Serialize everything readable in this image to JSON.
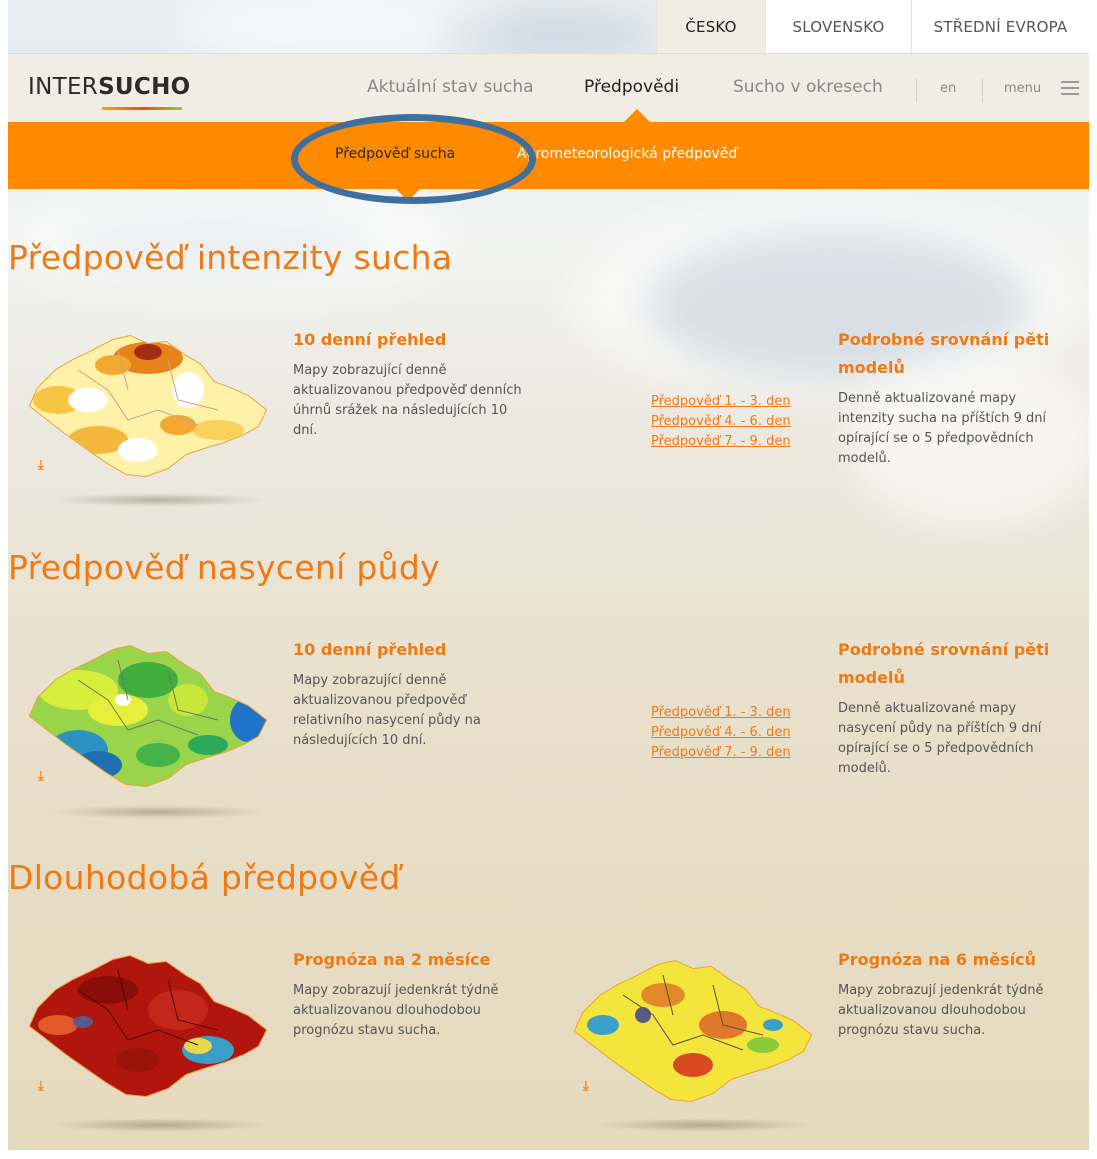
{
  "region_tabs": [
    "ČESKO",
    "SLOVENSKO",
    "STŘEDNÍ EVROPA"
  ],
  "logo": {
    "part1": "INTER",
    "part2": "SUCHO"
  },
  "nav": {
    "items": [
      "Aktuální stav sucha",
      "Předpovědi",
      "Sucho v okresech"
    ],
    "lang": "en",
    "menu": "menu"
  },
  "subnav": [
    "Předpověď sucha",
    "Agrometeorologická předpověď"
  ],
  "sections": [
    {
      "title": "Předpověď intenzity sucha",
      "left_card": {
        "title": "10 denní přehled",
        "text": [
          "Mapy zobrazující denně",
          "aktualizovanou předpověď denních",
          "úhrnů srážek na následujících 10",
          "dní."
        ]
      },
      "links": [
        "Předpověď 1. - 3. den",
        "Předpověď 4. - 6. den",
        "Předpověď 7. - 9. den"
      ],
      "right_card": {
        "title": [
          "Podrobné srovnání pěti",
          "modelů"
        ],
        "text": [
          "Denně aktualizované mapy",
          "intenzity sucha na příštích 9 dní",
          "opírající se o 5 předpovědních",
          "modelů."
        ]
      }
    },
    {
      "title": "Předpověď nasycení půdy",
      "left_card": {
        "title": "10 denní přehled",
        "text": [
          "Mapy zobrazující denně",
          "aktualizovanou předpověď",
          "relativního nasycení půdy na",
          "následujících 10 dní."
        ]
      },
      "links": [
        "Předpověď 1. - 3. den",
        "Předpověď 4. - 6. den",
        "Předpověď 7. - 9. den"
      ],
      "right_card": {
        "title": [
          "Podrobné srovnání pěti",
          "modelů"
        ],
        "text": [
          "Denně aktualizované mapy",
          "nasycení půdy na příštích 9 dní",
          "opírající se o 5 předpovědních",
          "modelů."
        ]
      }
    },
    {
      "title": "Dlouhodobá předpověď",
      "left_card": {
        "title": "Prognóza na 2 měsíce",
        "text": [
          "Mapy zobrazují jedenkrát týdně",
          "aktualizovanou dlouhodobou",
          "prognózu stavu sucha."
        ]
      },
      "right_card": {
        "title": "Prognóza na 6 měsíců",
        "text": [
          "Mapy zobrazují jedenkrát týdně",
          "aktualizovanou dlouhodobou",
          "prognózu stavu sucha."
        ]
      }
    }
  ],
  "icons": {
    "download": "download-icon",
    "menu": "hamburger-icon"
  },
  "colors": {
    "accent": "#ff8a00",
    "title": "#ee7a14",
    "highlight": "#3f6f9d"
  }
}
